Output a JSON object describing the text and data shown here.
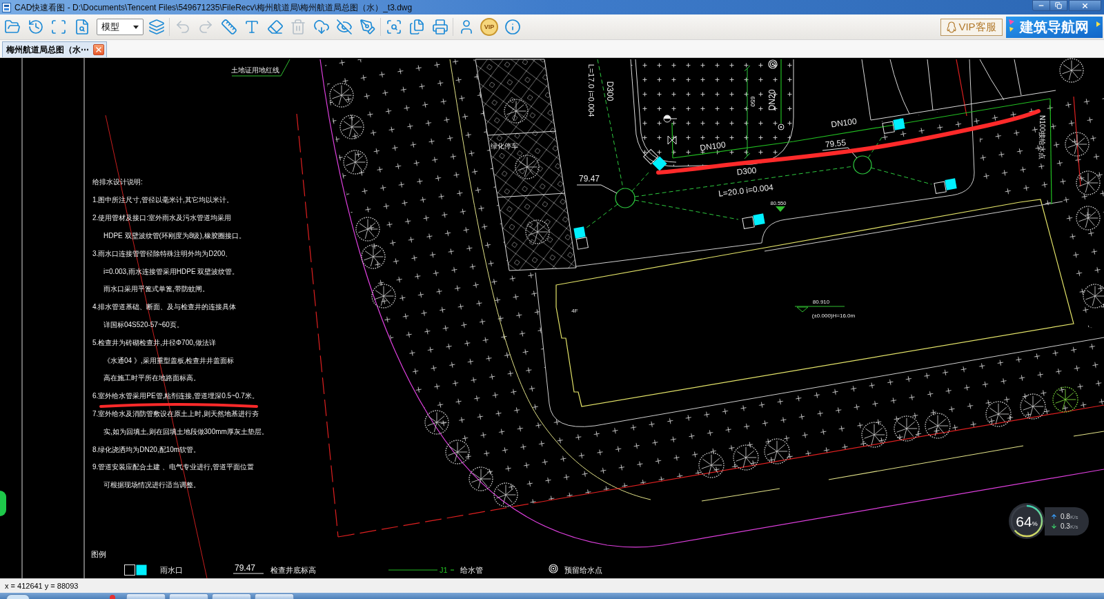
{
  "window": {
    "title": "CAD快速看图 - D:\\Documents\\Tencent Files\\549671235\\FileRecv\\梅州航道局\\梅州航道局总图（水）_t3.dwg"
  },
  "toolbar": {
    "tools_left": [
      {
        "kind": "open",
        "disabled": false
      },
      {
        "kind": "history",
        "disabled": false
      },
      {
        "kind": "fit",
        "disabled": false
      },
      {
        "kind": "zoom_window",
        "disabled": false
      }
    ],
    "layout_select": {
      "value": "模型"
    },
    "tool_groups": [
      [
        {
          "kind": "layers",
          "disabled": false
        }
      ],
      [
        {
          "kind": "undo",
          "disabled": true
        },
        {
          "kind": "redo",
          "disabled": true
        },
        {
          "kind": "measure",
          "disabled": false
        },
        {
          "kind": "text",
          "disabled": false
        },
        {
          "kind": "erase",
          "disabled": false
        },
        {
          "kind": "delete",
          "disabled": true
        },
        {
          "kind": "download",
          "disabled": false
        },
        {
          "kind": "hide",
          "disabled": false
        },
        {
          "kind": "settings",
          "disabled": false
        }
      ],
      [
        {
          "kind": "find_text",
          "disabled": false
        },
        {
          "kind": "compare",
          "disabled": false
        },
        {
          "kind": "print",
          "disabled": false
        }
      ],
      [
        {
          "kind": "account",
          "disabled": false
        },
        {
          "kind": "vip",
          "label": "VIP",
          "disabled": false
        },
        {
          "kind": "info",
          "disabled": false
        }
      ]
    ],
    "vip_service": {
      "label": "VIP客服"
    },
    "banner": {
      "text": "建筑导航网"
    }
  },
  "tabs": [
    {
      "label": "梅州航道局总图（水⋯",
      "selected": true
    }
  ],
  "drawing": {
    "notes": {
      "title": "给排水设计说明:",
      "lines": [
        {
          "kind": "item",
          "text": "1.图中所注尺寸,管径以毫米计,其它均以米计。"
        },
        {
          "kind": "item",
          "text": "2.使用管材及接口:室外雨水及污水管道均采用"
        },
        {
          "kind": "continuation",
          "text": "HDPE 双壁波纹管(环刚度为8级),橡胶圈接口。"
        },
        {
          "kind": "item",
          "text": "3.雨水口连接管管径除特殊注明外均为D200、"
        },
        {
          "kind": "continuation",
          "text": "i=0.003,雨水连接管采用HDPE 双壁波纹管。"
        },
        {
          "kind": "continuation",
          "text": "雨水口采用平篦式单篦,带防蚊闸。"
        },
        {
          "kind": "item",
          "text": "4.排水管道基础、断面、及与检查井的连接具体"
        },
        {
          "kind": "continuation",
          "text": "详国标04S520-57~60页。"
        },
        {
          "kind": "item",
          "text": "5.检查井为砖砌检查井,井径Φ700,做法详"
        },
        {
          "kind": "continuation",
          "text": "《水通04 》,采用重型盖板,检查井井盖面标"
        },
        {
          "kind": "continuation",
          "text": "高在施工时平所在地路面标高。"
        },
        {
          "kind": "item",
          "text": "6.室外给水管采用PE管,粘剂连接,管道埋深0.5~0.7米。"
        },
        {
          "kind": "item",
          "text": "7.室外给水及消防管敷设在原土上时,则天然地基进行夯"
        },
        {
          "kind": "continuation",
          "text": "实,如为回填土,则在回填土地段做300mm厚灰土垫层。"
        },
        {
          "kind": "item",
          "text": "8.绿化浇洒均为DN20,配10m软管。"
        },
        {
          "kind": "item",
          "text": "9.管道安装应配合土建 、电气专业进行,管道平面位置"
        },
        {
          "kind": "continuation",
          "text": "可根据现场情况进行适当调整。"
        }
      ]
    },
    "labels": [
      "土地证用地红线",
      "L=17.0 i=0.004",
      "D300",
      "650",
      "DN20",
      "DN100",
      "N100接给水点",
      "绿化停车",
      "DN100",
      "79.55",
      "D300",
      "79.47",
      "L=20.0 i=0.004",
      "80.550",
      "80.910",
      "4F",
      "(±0.000)H=16.0m"
    ],
    "legend": {
      "title": "图例",
      "items": [
        {
          "kind": "inlet",
          "label": "雨水口"
        },
        {
          "kind": "elevation",
          "sample": "79.47",
          "label": "检查井底标高"
        },
        {
          "kind": "pipe",
          "sample": "J1",
          "label": "给水管"
        },
        {
          "kind": "water_point",
          "label": "预留给水点"
        }
      ]
    }
  },
  "network_monitor": {
    "percent": "64",
    "unit": "%",
    "level": 0.64,
    "upload": {
      "value": "0.8",
      "unit": "K/s"
    },
    "download": {
      "value": "0.3",
      "unit": "K/s"
    }
  },
  "status_bar": {
    "coordinates": "x = 412641 y = 88093"
  }
}
